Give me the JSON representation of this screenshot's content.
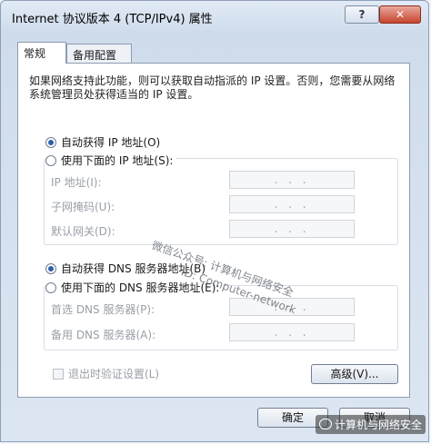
{
  "window": {
    "title": "Internet 协议版本 4 (TCP/IPv4) 属性",
    "help_label": "?",
    "close_label": "✕"
  },
  "tabs": [
    {
      "label": "常规",
      "active": true
    },
    {
      "label": "备用配置",
      "active": false
    }
  ],
  "description": "如果网络支持此功能，则可以获取自动指派的 IP 设置。否则，您需要从网络系统管理员处获得适当的 IP 设置。",
  "ip": {
    "auto_label": "自动获得 IP 地址(O)",
    "manual_label": "使用下面的 IP 地址(S):",
    "auto_selected": true,
    "fields": [
      {
        "label": "IP 地址(I):",
        "value": ". . ."
      },
      {
        "label": "子网掩码(U):",
        "value": ". . ."
      },
      {
        "label": "默认网关(D):",
        "value": ". . ."
      }
    ]
  },
  "dns": {
    "auto_label": "自动获得 DNS 服务器地址(B)",
    "manual_label": "使用下面的 DNS 服务器地址(E):",
    "auto_selected": true,
    "fields": [
      {
        "label": "首选 DNS 服务器(P):",
        "value": ". . ."
      },
      {
        "label": "备用 DNS 服务器(A):",
        "value": ". . ."
      }
    ]
  },
  "validate_label": "退出时验证设置(L)",
  "advanced_label": "高级(V)...",
  "ok_label": "确定",
  "cancel_label": "取消",
  "watermark": {
    "line1": "微信公众号: 计算机与网络安全",
    "line2": "ID: Computer-network"
  },
  "footer_watermark": "计算机与网络安全"
}
